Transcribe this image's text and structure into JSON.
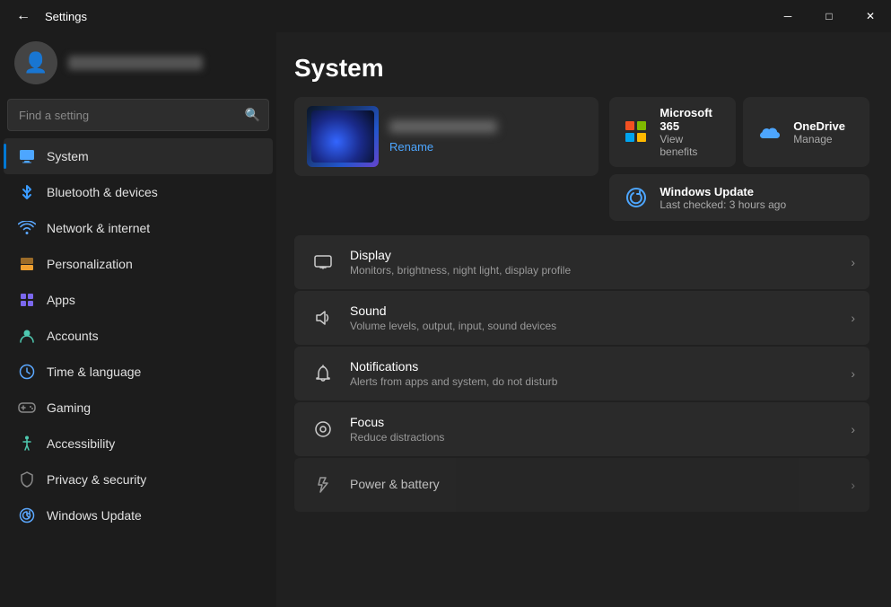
{
  "titleBar": {
    "title": "Settings",
    "minimizeLabel": "─",
    "maximizeLabel": "□",
    "closeLabel": "✕"
  },
  "sidebar": {
    "searchPlaceholder": "Find a setting",
    "navItems": [
      {
        "id": "system",
        "label": "System",
        "icon": "🖥",
        "active": true
      },
      {
        "id": "bluetooth",
        "label": "Bluetooth & devices",
        "icon": "bluetooth",
        "active": false
      },
      {
        "id": "network",
        "label": "Network & internet",
        "icon": "wifi",
        "active": false
      },
      {
        "id": "personalization",
        "label": "Personalization",
        "icon": "✏️",
        "active": false
      },
      {
        "id": "apps",
        "label": "Apps",
        "icon": "apps",
        "active": false,
        "arrow": true
      },
      {
        "id": "accounts",
        "label": "Accounts",
        "icon": "accounts",
        "active": false
      },
      {
        "id": "time",
        "label": "Time & language",
        "icon": "time",
        "active": false
      },
      {
        "id": "gaming",
        "label": "Gaming",
        "icon": "gaming",
        "active": false
      },
      {
        "id": "accessibility",
        "label": "Accessibility",
        "icon": "♿",
        "active": false
      },
      {
        "id": "privacy",
        "label": "Privacy & security",
        "icon": "privacy",
        "active": false
      },
      {
        "id": "windows-update",
        "label": "Windows Update",
        "icon": "update",
        "active": false
      }
    ]
  },
  "main": {
    "pageTitle": "System",
    "deviceCard": {
      "renameLabel": "Rename"
    },
    "infoCards": [
      {
        "id": "ms365",
        "title": "Microsoft 365",
        "subtitle": "View benefits"
      },
      {
        "id": "onedrive",
        "title": "OneDrive",
        "subtitle": "Manage"
      },
      {
        "id": "windows-update",
        "title": "Windows Update",
        "subtitle": "Last checked: 3 hours ago"
      }
    ],
    "settingsItems": [
      {
        "id": "display",
        "icon": "display",
        "title": "Display",
        "subtitle": "Monitors, brightness, night light, display profile"
      },
      {
        "id": "sound",
        "icon": "sound",
        "title": "Sound",
        "subtitle": "Volume levels, output, input, sound devices"
      },
      {
        "id": "notifications",
        "icon": "notifications",
        "title": "Notifications",
        "subtitle": "Alerts from apps and system, do not disturb"
      },
      {
        "id": "focus",
        "icon": "focus",
        "title": "Focus",
        "subtitle": "Reduce distractions"
      },
      {
        "id": "power",
        "icon": "power",
        "title": "Power & battery",
        "subtitle": ""
      }
    ]
  }
}
